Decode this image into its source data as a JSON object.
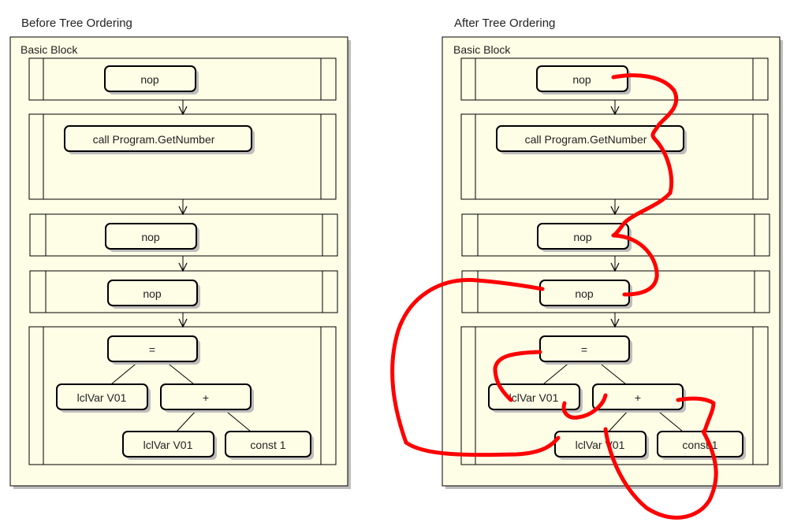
{
  "colors": {
    "panel_fill": "#FEFDE6",
    "node_fill": "#FEFDE6",
    "stroke": "#000000",
    "shadow": "#BDBDBD",
    "annotation": "#FF0000"
  },
  "panels": [
    {
      "title": "Before Tree Ordering",
      "block_label": "Basic Block",
      "nodes": {
        "nop1": "nop",
        "call": "call Program.GetNumber",
        "nop2": "nop",
        "nop3": "nop",
        "assign": "=",
        "lclvar_a": "lclVar V01",
        "plus": "+",
        "lclvar_b": "lclVar V01",
        "const": "const 1"
      }
    },
    {
      "title": "After Tree Ordering",
      "block_label": "Basic Block",
      "nodes": {
        "nop1": "nop",
        "call": "call Program.GetNumber",
        "nop2": "nop",
        "nop3": "nop",
        "assign": "=",
        "lclvar_a": "lclVar V01",
        "plus": "+",
        "lclvar_b": "lclVar V01",
        "const": "const 1"
      }
    }
  ]
}
